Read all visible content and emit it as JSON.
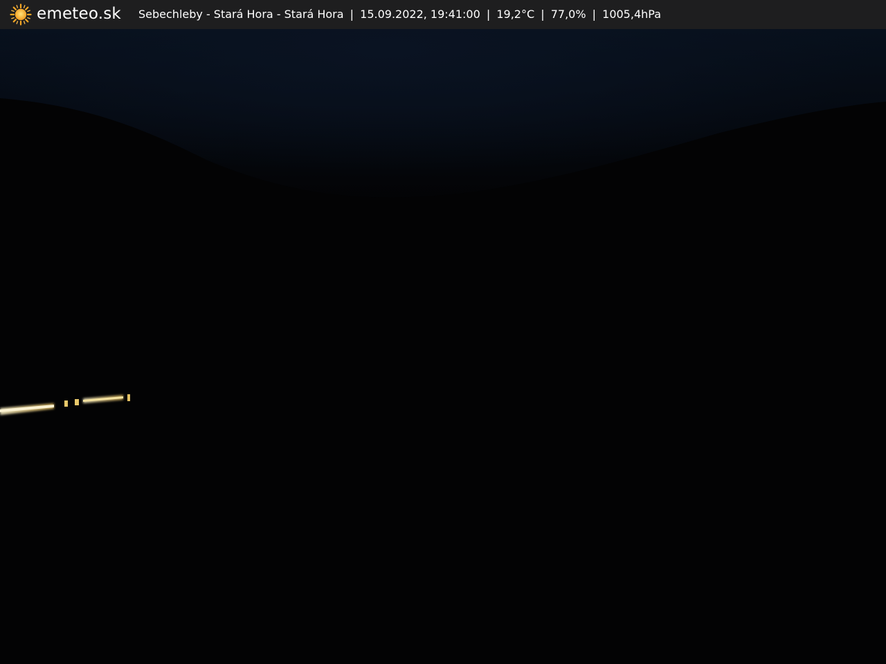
{
  "header": {
    "brand": "emeteo.sk",
    "logo_icon": "sun-icon",
    "location": "Sebechleby - Stará Hora - Stará Hora",
    "datetime": "15.09.2022, 19:41:00",
    "temperature": "19,2°C",
    "humidity": "77,0%",
    "pressure": "1005,4hPa",
    "separator": "|"
  },
  "colors": {
    "bar_background": "#1e1e1f",
    "sun": "#f5a623",
    "sky": "#0a1322",
    "light_streak": "#f3e7b8"
  }
}
